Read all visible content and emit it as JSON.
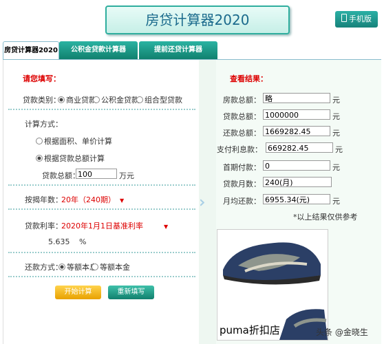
{
  "header": {
    "title": "房贷计算器2020",
    "mobile_label": "手机版"
  },
  "tabs": [
    {
      "label": "房贷计算器2020"
    },
    {
      "label": "公积金贷款计算器"
    },
    {
      "label": "提前还贷计算器"
    }
  ],
  "form": {
    "heading": "请您填写：",
    "loan_type": {
      "label": "贷款类别：",
      "options": [
        "商业贷款",
        "公积金贷款",
        "组合型贷款"
      ],
      "selected": 0
    },
    "calc_method": {
      "label": "计算方式：",
      "options": [
        "根据面积、单价计算",
        "根据贷款总额计算"
      ],
      "selected": 1
    },
    "loan_total": {
      "label": "贷款总额：",
      "value": "100",
      "unit": "万元"
    },
    "years": {
      "label": "按揭年数：",
      "value": "20年（240期）"
    },
    "rate": {
      "label": "贷款利率：",
      "value": "2020年1月1日基准利率",
      "number": "5.635",
      "unit": "%"
    },
    "repay": {
      "label": "还款方式：",
      "options": [
        "等额本息",
        "等额本金"
      ],
      "selected": 0
    },
    "submit_label": "开始计算",
    "reset_label": "重新填写"
  },
  "results": {
    "heading": "查看结果：",
    "rows": [
      {
        "label": "房款总额：",
        "value": "略",
        "unit": "元"
      },
      {
        "label": "贷款总额：",
        "value": "1000000",
        "unit": "元"
      },
      {
        "label": "还款总额：",
        "value": "1669282.45",
        "unit": "元"
      },
      {
        "label": "支付利息款：",
        "value": "669282.45",
        "unit": "元"
      },
      {
        "label": "首期付款：",
        "value": "0",
        "unit": "元"
      },
      {
        "label": "贷款月数：",
        "value": "240(月)",
        "unit": ""
      },
      {
        "label": "月均还款：",
        "value": "6955.34(元)",
        "unit": "元"
      }
    ],
    "note": "*以上结果仅供参考"
  },
  "ad": {
    "caption": "puma折扣店"
  },
  "watermark": "头条 @金晓生"
}
